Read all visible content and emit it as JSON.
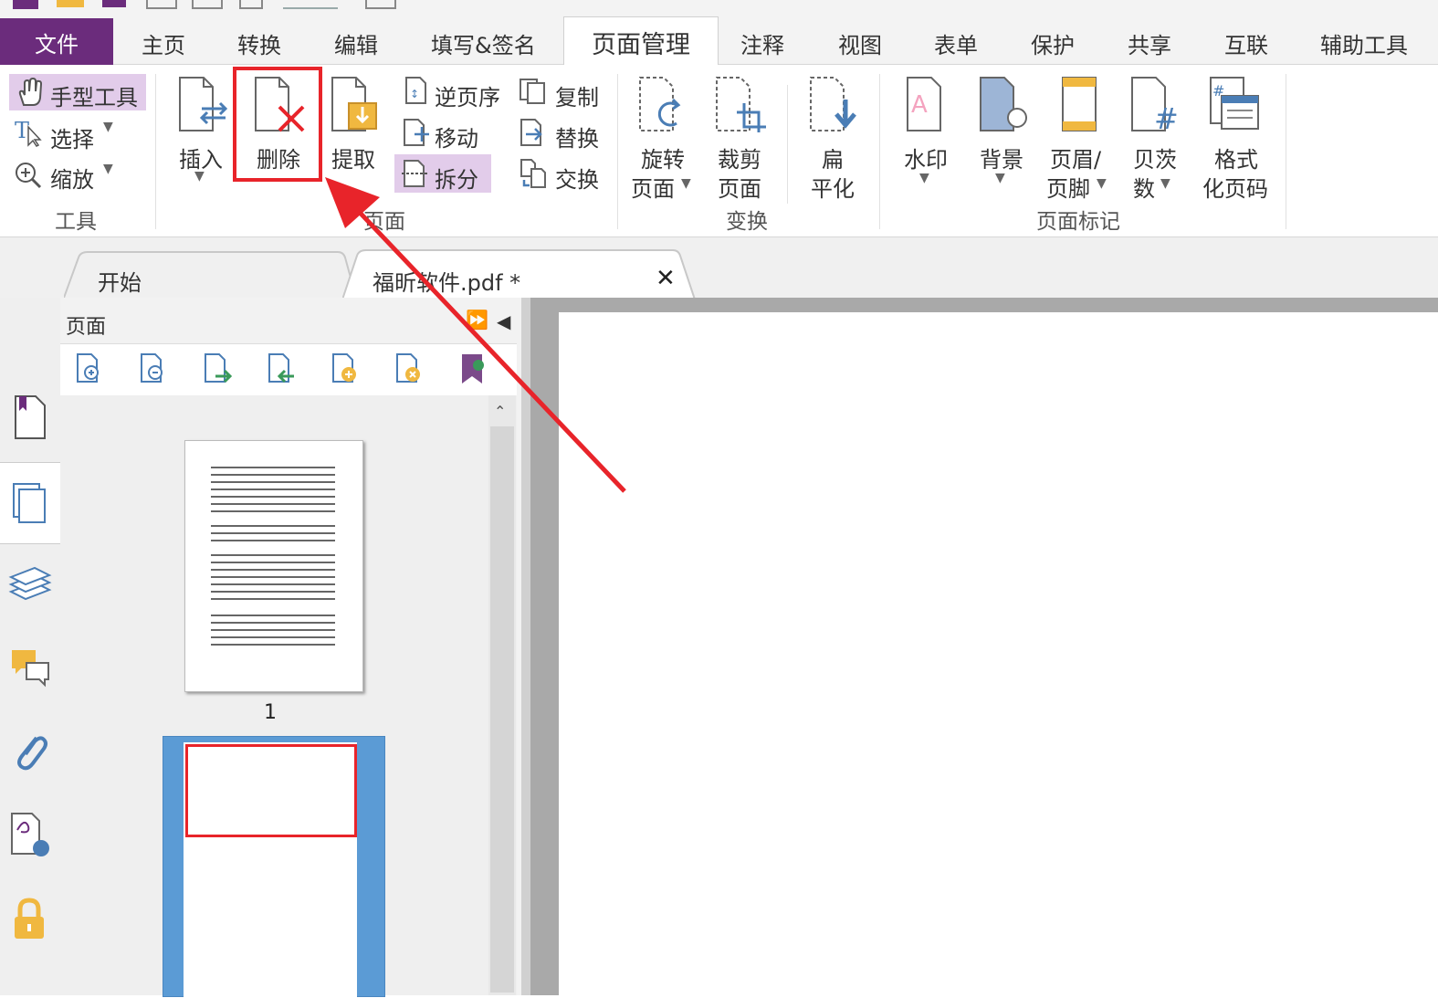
{
  "ribbon_tabs": {
    "file": "文件",
    "home": "主页",
    "convert": "转换",
    "edit": "编辑",
    "fill_sign": "填写&签名",
    "page_management": "页面管理",
    "comment": "注释",
    "view": "视图",
    "form": "表单",
    "protect": "保护",
    "share": "共享",
    "connect": "互联",
    "accessibility": "辅助工具"
  },
  "tools_group": {
    "hand_tool": "手型工具",
    "select": "选择",
    "zoom": "缩放",
    "label": "工具"
  },
  "pages_group": {
    "insert": "插入",
    "delete": "删除",
    "extract": "提取",
    "reverse": "逆页序",
    "move": "移动",
    "split": "拆分",
    "copy": "复制",
    "replace": "替换",
    "swap": "交换",
    "label": "页面"
  },
  "transform_group": {
    "rotate_line1": "旋转",
    "rotate_line2": "页面",
    "crop_line1": "裁剪",
    "crop_line2": "页面",
    "flatten_line1": "扁",
    "flatten_line2": "平化",
    "label": "变换"
  },
  "mark_group": {
    "watermark": "水印",
    "background": "背景",
    "header_line1": "页眉/",
    "header_line2": "页脚",
    "bates_line1": "贝茨",
    "bates_line2": "数",
    "format_line1": "格式",
    "format_line2": "化页码",
    "label": "页面标记"
  },
  "doc_tabs": {
    "start": "开始",
    "file": "福昕软件.pdf *"
  },
  "panel": {
    "title": "页面",
    "page1_number": "1"
  },
  "colors": {
    "file_tab": "#6b2c7c",
    "highlight": "#e2ccea",
    "annotation_red": "#e8242a",
    "selected_thumb": "#5b9bd5"
  }
}
